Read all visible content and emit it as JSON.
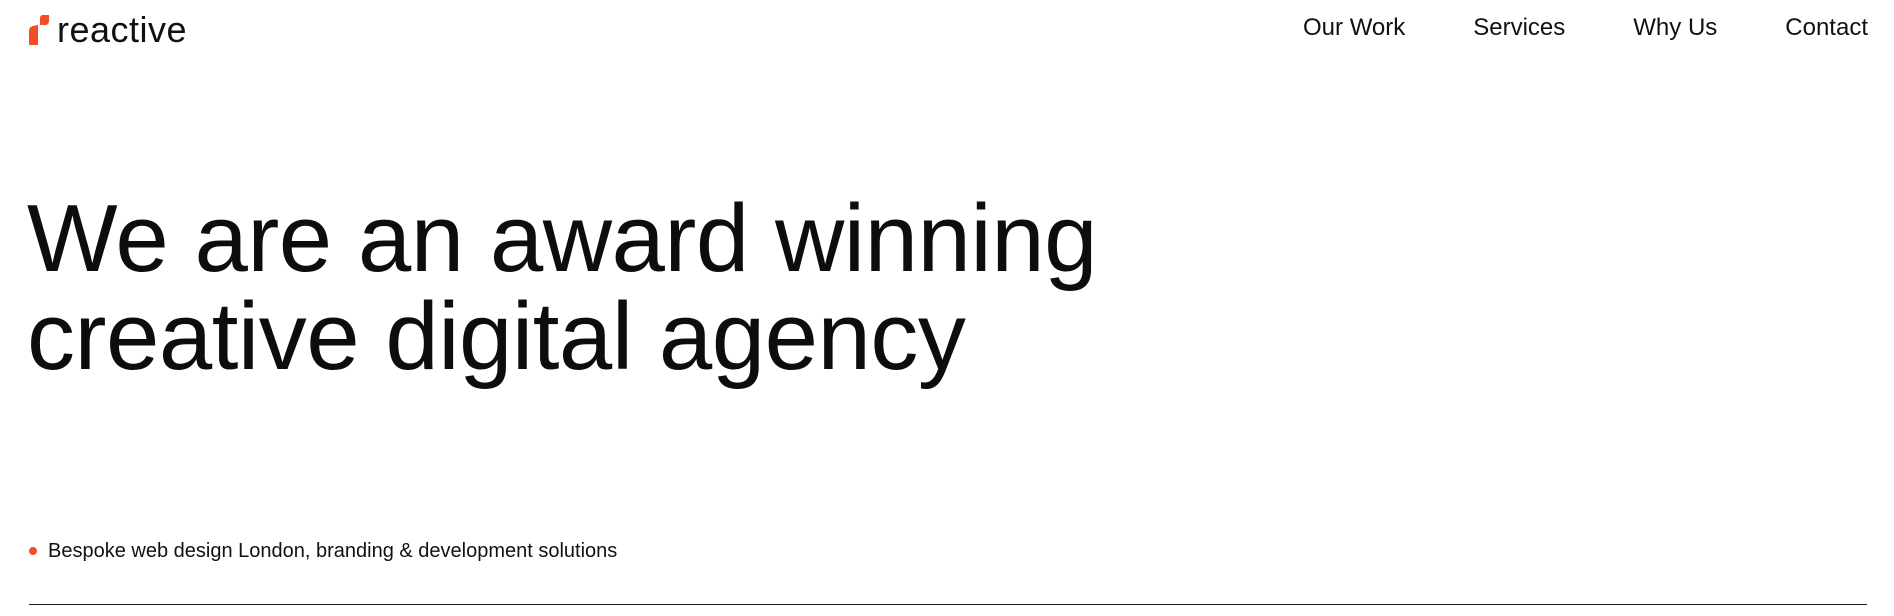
{
  "brand": {
    "name": "reactive",
    "accent_color": "#f04e23",
    "logo_icon": "reactive-logo-mark-icon"
  },
  "nav": {
    "items": [
      {
        "label": "Our Work"
      },
      {
        "label": "Services"
      },
      {
        "label": "Why Us"
      },
      {
        "label": "Contact"
      }
    ]
  },
  "hero": {
    "headline_line1": "We are an award winning",
    "headline_line2": "creative digital agency",
    "tagline": "Bespoke web design London, branding & development solutions",
    "bullet_icon": "bullet-dot-icon"
  }
}
